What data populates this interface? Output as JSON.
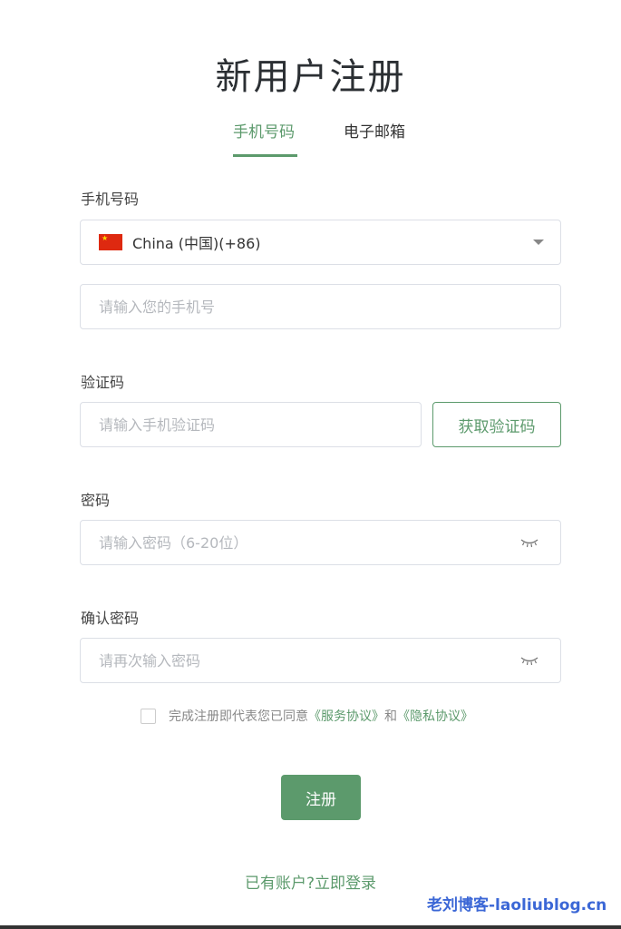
{
  "title": "新用户注册",
  "tabs": [
    {
      "label": "手机号码",
      "active": true
    },
    {
      "label": "电子邮箱",
      "active": false
    }
  ],
  "phone_section": {
    "label": "手机号码",
    "country": "China (中国)(+86)",
    "phone_placeholder": "请输入您的手机号"
  },
  "code_section": {
    "label": "验证码",
    "placeholder": "请输入手机验证码",
    "get_code_label": "获取验证码"
  },
  "password_section": {
    "label": "密码",
    "placeholder": "请输入密码（6-20位）"
  },
  "confirm_section": {
    "label": "确认密码",
    "placeholder": "请再次输入密码"
  },
  "agreement": {
    "prefix": "完成注册即代表您已同意",
    "service_link": "《服务协议》",
    "and": "和",
    "privacy_link": "《隐私协议》"
  },
  "submit_label": "注册",
  "login_link": "已有账户?立即登录",
  "watermark": "老刘博客-laoliublog.cn",
  "colors": {
    "accent": "#5c9a6c",
    "border": "#dcdfe6",
    "placeholder": "#b5b8bd",
    "watermark": "#3b67d6"
  },
  "icons": {
    "country_flag": "china-flag-icon",
    "dropdown": "caret-down-icon",
    "password_toggle": "eye-closed-icon"
  }
}
